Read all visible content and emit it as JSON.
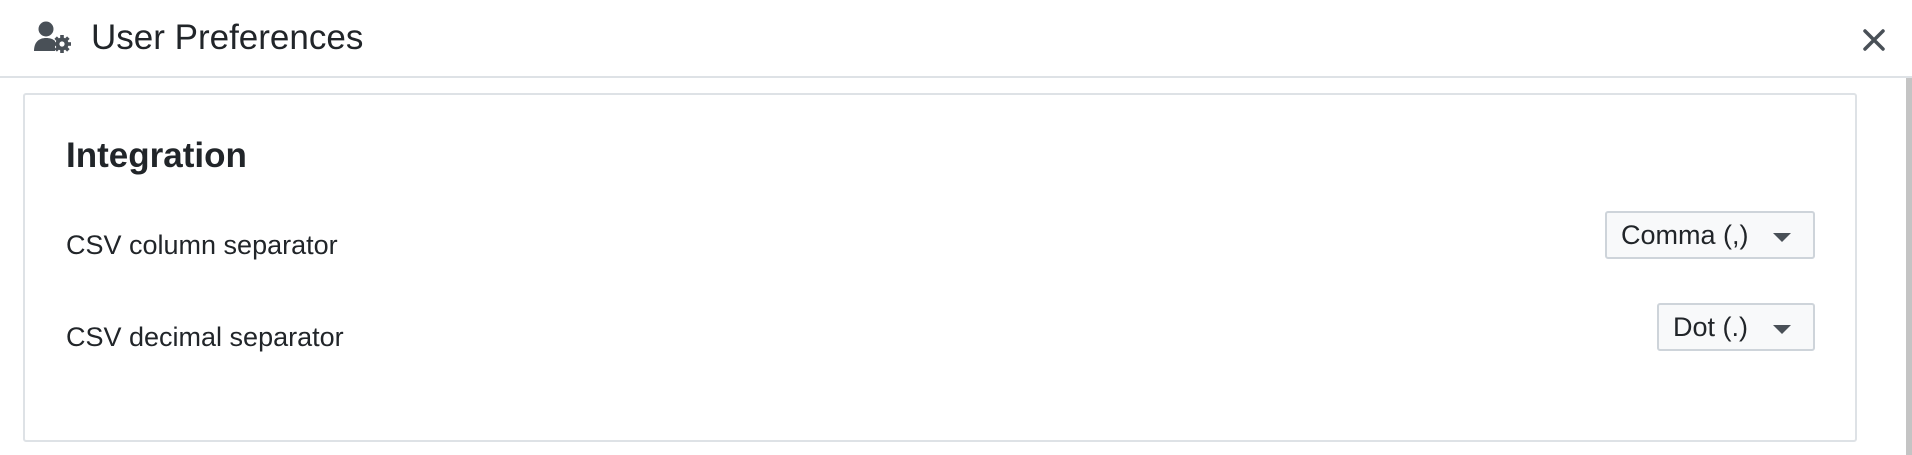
{
  "dialog": {
    "title": "User Preferences",
    "title_icon": "user-gear-icon",
    "close_icon": "close-icon"
  },
  "section": {
    "title": "Integration",
    "rows": [
      {
        "label": "CSV column separator",
        "value": "Comma (,)"
      },
      {
        "label": "CSV decimal separator",
        "value": "Dot (.)"
      }
    ]
  },
  "colors": {
    "text": "#212529",
    "icon": "#495057",
    "border": "#dee2e6"
  }
}
